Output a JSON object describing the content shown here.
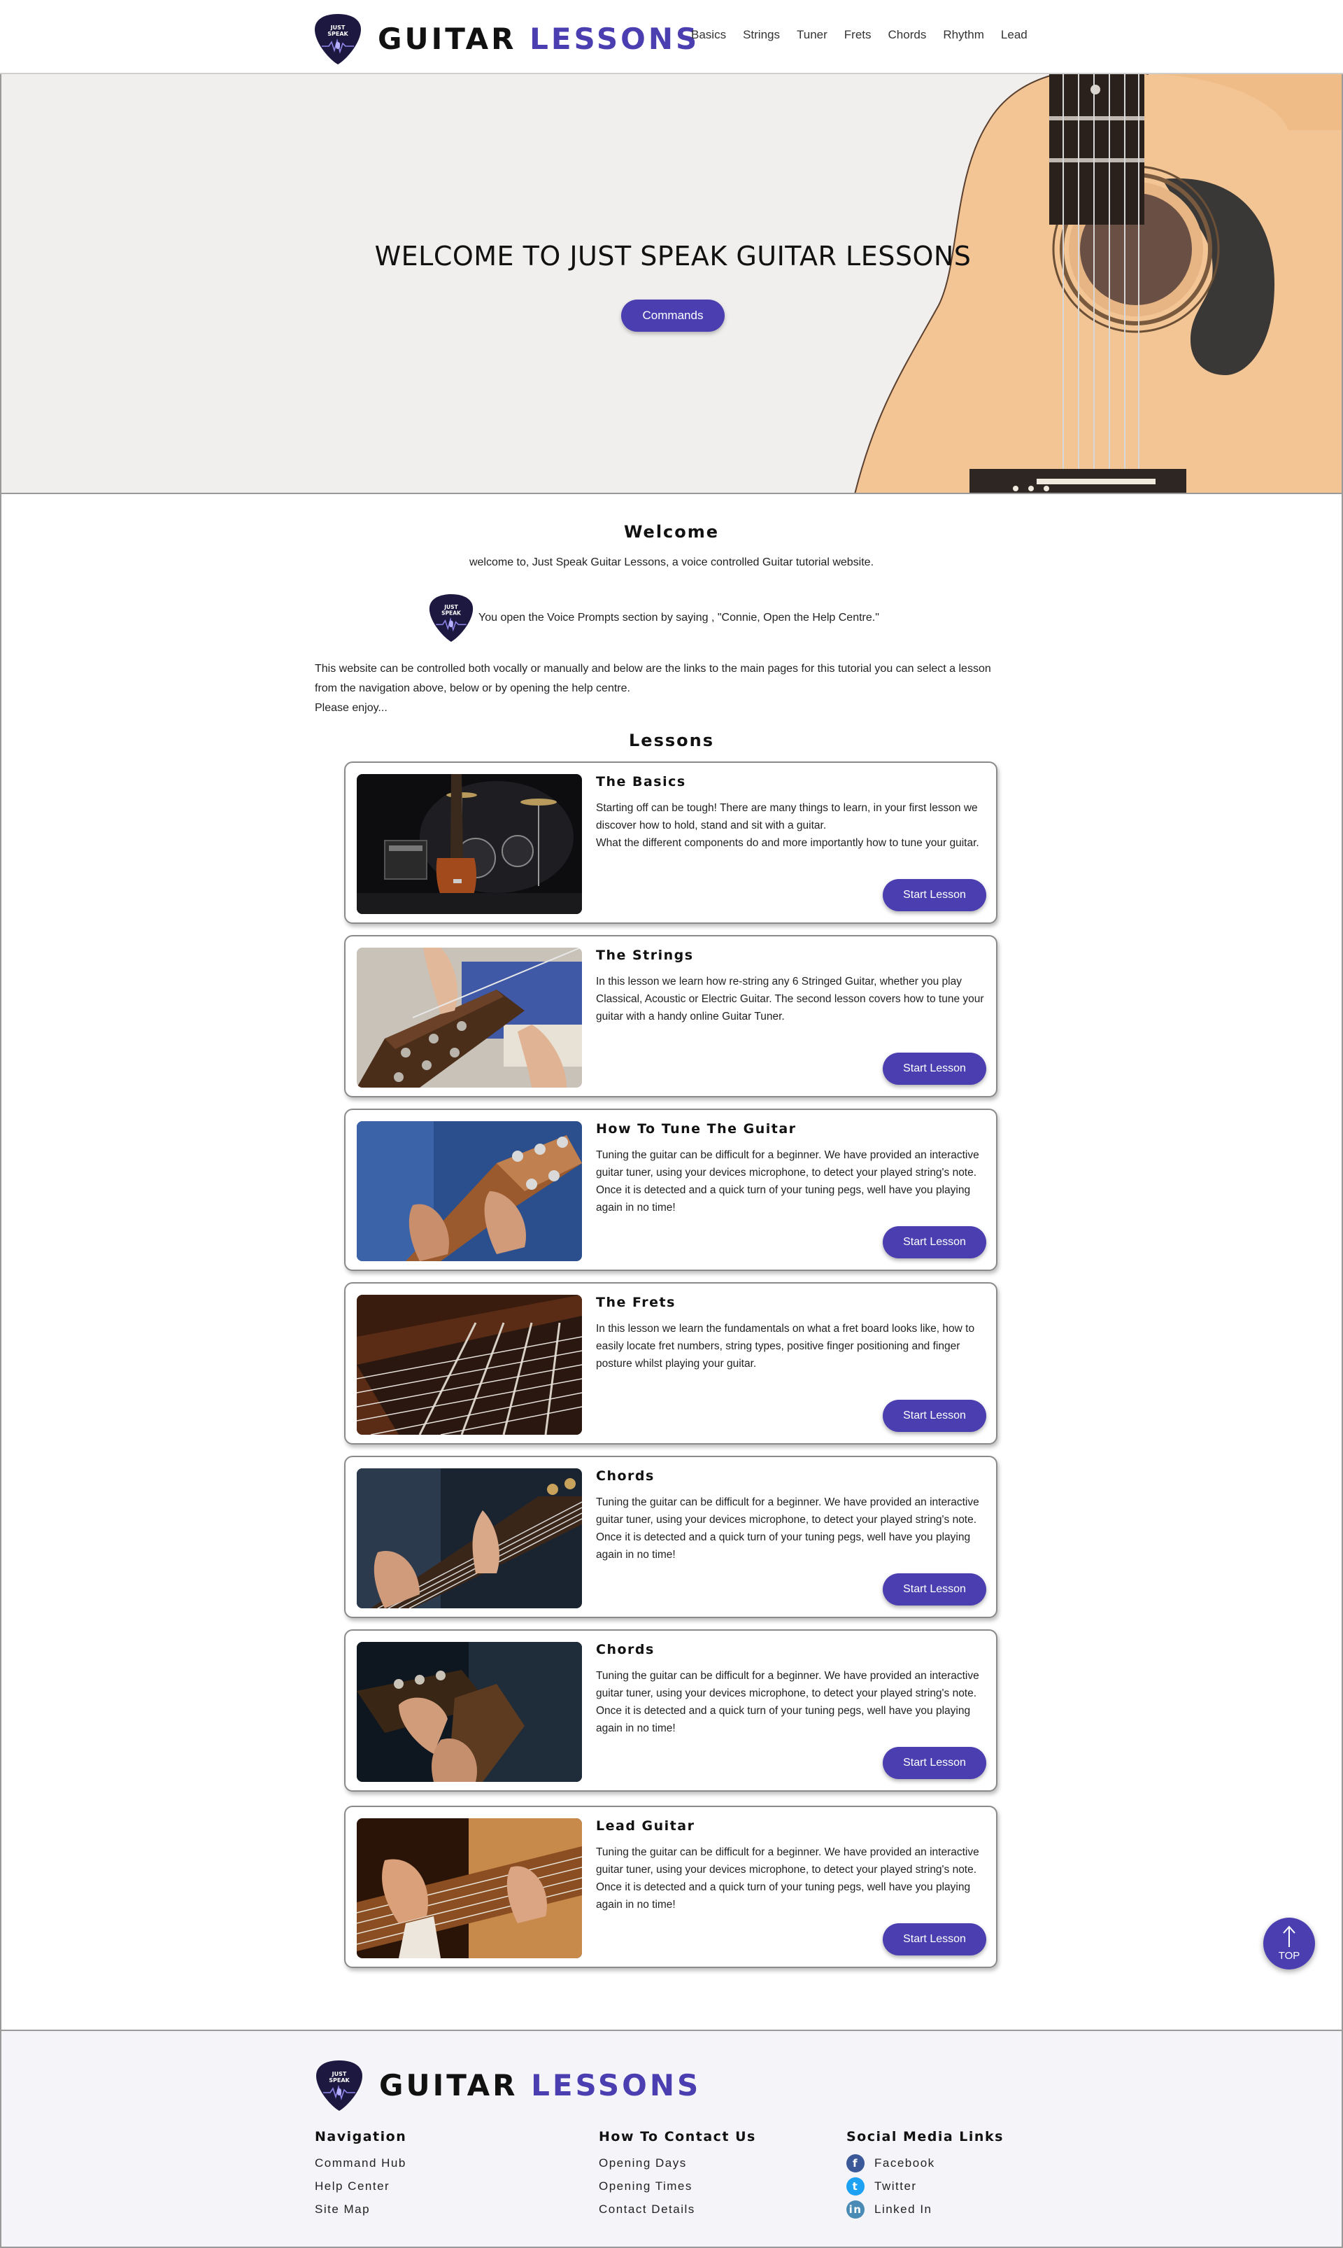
{
  "header": {
    "logo_small_line1": "JUST",
    "logo_small_line2": "SPEAK",
    "brand_word1": "GUITAR",
    "brand_word2": "LESSONS",
    "nav": [
      "Basics",
      "Strings",
      "Tuner",
      "Frets",
      "Chords",
      "Rhythm",
      "Lead"
    ]
  },
  "hero": {
    "title": "WELCOME TO JUST SPEAK GUITAR LESSONS",
    "button": "Commands"
  },
  "welcome": {
    "title": "Welcome",
    "line": "welcome to, Just Speak Guitar Lessons, a voice controlled Guitar tutorial website.",
    "prompt": "You open the Voice Prompts section by saying , \"Connie, Open the Help Centre.\"",
    "intro": "This website can be controlled both vocally or manually and below are the links to the main pages for this tutorial you can select a lesson from the navigation above, below or by opening the help centre.\nPlease enjoy..."
  },
  "lessons": {
    "title": "Lessons",
    "items": [
      {
        "title": "The Basics",
        "desc": "Starting off can be tough! There are many things to learn, in your first lesson we discover how to hold, stand and sit with a guitar.\nWhat the different components do and more importantly how to tune your guitar.",
        "button": "Start Lesson",
        "image": "stage-guitar-drums-photo"
      },
      {
        "title": "The Strings",
        "desc": " In this lesson we learn how re-string any 6 Stringed Guitar,  whether you play Classical, Acoustic or Electric Guitar. The second lesson covers how to tune your guitar with a handy online Guitar Tuner.",
        "button": "Start Lesson",
        "image": "restringing-headstock-photo"
      },
      {
        "title": "How To Tune The Guitar",
        "desc": "Tuning the guitar can be difficult for a beginner. We have provided an interactive guitar tuner, using your devices microphone, to detect your played string's note. Once it is detected and a quick turn of your tuning pegs, well have you playing again in no time!",
        "button": "Start Lesson",
        "image": "tuning-pegs-photo"
      },
      {
        "title": "The Frets",
        "desc": "In this lesson we learn the fundamentals on what a fret board looks like, how to easily locate fret numbers, string types, positive finger positioning and finger posture whilst playing your guitar.",
        "button": "Start Lesson",
        "image": "fretboard-closeup-photo"
      },
      {
        "title": "Chords",
        "desc": "Tuning the guitar can be difficult for a beginner. We have provided an interactive guitar tuner, using your devices microphone, to detect your played string's note. Once it is detected and a quick turn of your tuning pegs, well have you playing again in no time!",
        "button": "Start Lesson",
        "image": "chord-hand-photo"
      },
      {
        "title": "Chords",
        "desc": "Tuning the guitar can be difficult for a beginner. We have provided an interactive guitar tuner, using your devices microphone, to detect your played string's note. Once it is detected and a quick turn of your tuning pegs, well have you playing again in no time!",
        "button": "Start Lesson",
        "image": "electric-guitar-player-photo"
      },
      {
        "title": "Lead Guitar",
        "desc": "Tuning the guitar can be difficult for a beginner. We have provided an interactive guitar tuner, using your devices microphone, to detect your played string's note. Once it is detected and a quick turn of your tuning pegs, well have you playing again in no time!",
        "button": "Start Lesson",
        "image": "lead-guitar-hands-photo"
      }
    ]
  },
  "top_button": "TOP",
  "footer": {
    "navigation": {
      "title": "Navigation",
      "links": [
        "Command Hub",
        "Help Center",
        "Site Map"
      ]
    },
    "contact": {
      "title": "How To Contact Us",
      "links": [
        "Opening Days",
        "Opening Times",
        "Contact Details"
      ]
    },
    "social": {
      "title": "Social Media Links",
      "links": [
        {
          "label": "Facebook",
          "icon": "facebook-icon",
          "color": "#3b5998"
        },
        {
          "label": "Twitter",
          "icon": "twitter-icon",
          "color": "#1da1f2"
        },
        {
          "label": "Linked In",
          "icon": "linkedin-icon",
          "color": "#4a8bb5"
        }
      ]
    }
  },
  "colors": {
    "accent": "#4a3eb0",
    "pick": "#1c1840"
  }
}
